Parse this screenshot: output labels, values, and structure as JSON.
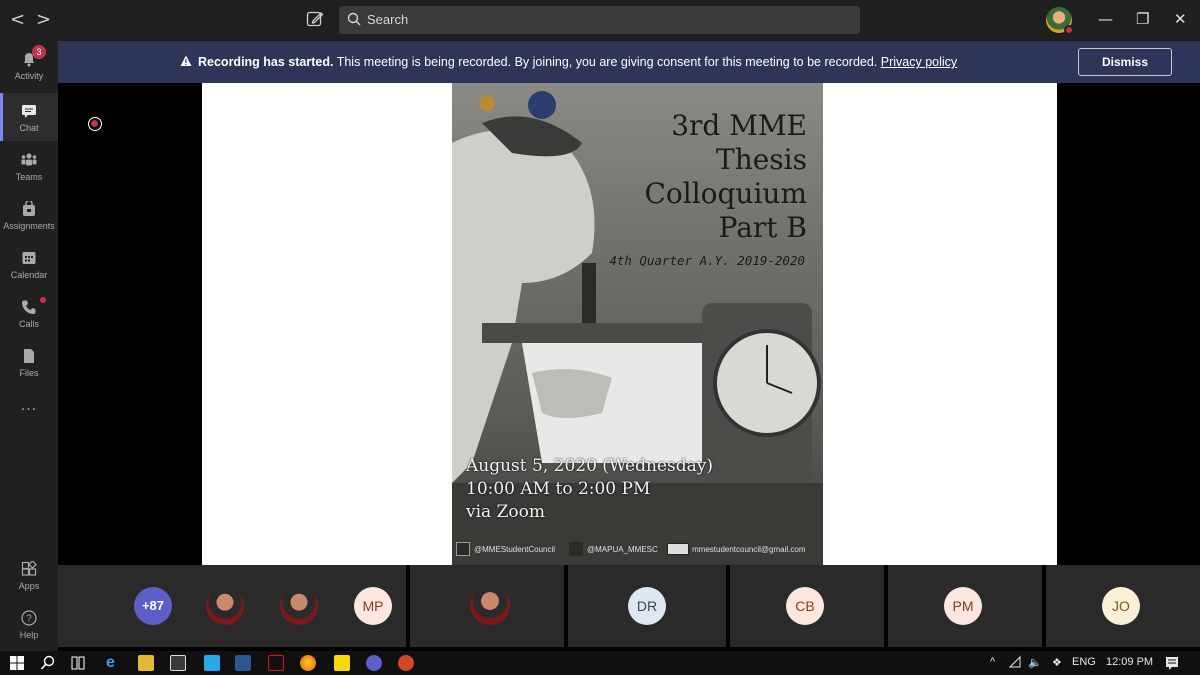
{
  "titlebar": {
    "search_placeholder": "Search",
    "back_glyph": "<",
    "forward_glyph": ">"
  },
  "rail": {
    "items": [
      {
        "label": "Activity",
        "icon": "bell-icon",
        "badge": "3"
      },
      {
        "label": "Chat",
        "icon": "chat-icon"
      },
      {
        "label": "Teams",
        "icon": "teams-icon"
      },
      {
        "label": "Assignments",
        "icon": "assignments-icon"
      },
      {
        "label": "Calendar",
        "icon": "calendar-icon"
      },
      {
        "label": "Calls",
        "icon": "phone-icon"
      },
      {
        "label": "Files",
        "icon": "files-icon"
      },
      {
        "label": "...",
        "icon": "more-icon"
      },
      {
        "label": "Apps",
        "icon": "apps-icon"
      },
      {
        "label": "Help",
        "icon": "help-icon"
      }
    ]
  },
  "banner": {
    "bold": "Recording has started.",
    "text": " This meeting is being recorded. By joining, you are giving consent for this meeting to be recorded. ",
    "link": "Privacy policy",
    "dismiss": "Dismiss"
  },
  "poster": {
    "title_lines": [
      "3rd MME",
      "Thesis",
      "Colloquium",
      "Part B"
    ],
    "subtitle": "4th Quarter A.Y. 2019-2020",
    "date_line": "August 5, 2020 (Wednesday)",
    "time_line": "10:00 AM to 2:00 PM",
    "venue_line": "via Zoom",
    "facebook": "@MMEStudentCouncil",
    "twitter": "@MAPUA_MMESC",
    "email": "mmestudentcouncil@gmail.com"
  },
  "participants": [
    {
      "type": "more",
      "label": "+87"
    },
    {
      "type": "photo",
      "label": ""
    },
    {
      "type": "photo",
      "label": ""
    },
    {
      "type": "initials",
      "label": "MP"
    },
    {
      "type": "photo",
      "label": ""
    },
    {
      "type": "initials",
      "label": "DR"
    },
    {
      "type": "initials",
      "label": "CB"
    },
    {
      "type": "initials",
      "label": "PM"
    },
    {
      "type": "initials",
      "label": "JO"
    }
  ],
  "taskbar": {
    "lang": "ENG",
    "time": "12:09 PM"
  },
  "colors": {
    "banner_bg": "#2e3558",
    "accent": "#7f85f5",
    "notify_red": "#c4314b"
  }
}
